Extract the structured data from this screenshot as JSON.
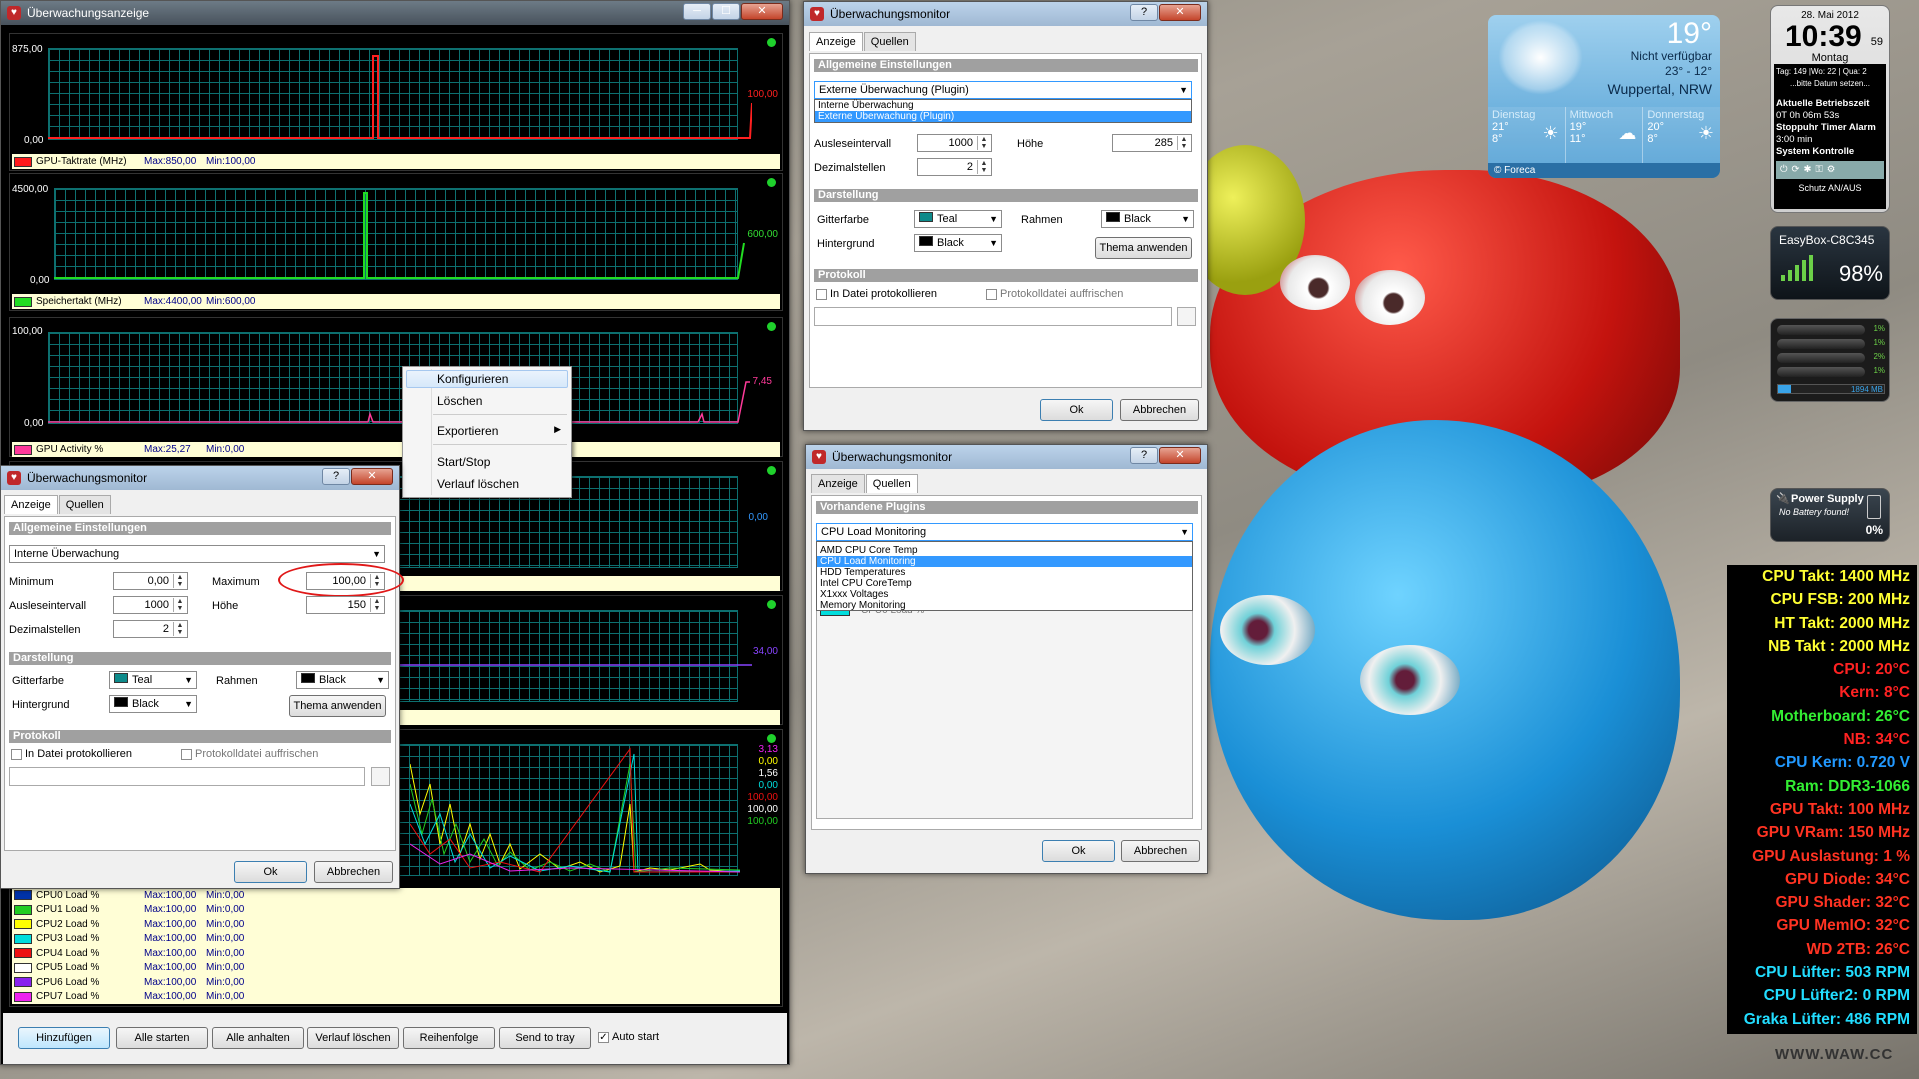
{
  "main_window": {
    "title": "Überwachungsanzeige",
    "btn_min": "─",
    "btn_max": "☐",
    "btn_close": "✕",
    "panels": [
      {
        "top_label": "875,00",
        "bottom_label": "0,00",
        "right_value": "100,00",
        "right_color": "#ff2020",
        "legend": {
          "name": "GPU-Taktrate (MHz)",
          "max": "Max:850,00",
          "min": "Min:100,00",
          "color": "#ff1a1a"
        }
      },
      {
        "top_label": "4500,00",
        "bottom_label": "0,00",
        "right_value": "600,00",
        "right_color": "#33dd33",
        "legend": {
          "name": "Speichertakt (MHz)",
          "max": "Max:4400,00",
          "min": "Min:600,00",
          "color": "#22dd22"
        }
      },
      {
        "top_label": "100,00",
        "bottom_label": "0,00",
        "right_value": "7,45",
        "right_color": "#ff3a9a",
        "legend": {
          "name": "GPU Activity %",
          "max": "Max:25,27",
          "min": "Min:0,00",
          "color": "#ff3a9a"
        }
      },
      {
        "right_value": "0,00",
        "right_color": "#3399ff"
      },
      {
        "right_value": "34,00",
        "right_color": "#8844ff"
      },
      {
        "right_values": [
          "3,13",
          "0,00",
          "1,56",
          "0,00",
          "100,00",
          "100,00",
          "100,00"
        ]
      }
    ],
    "cpu_legend": [
      {
        "name": "CPU0 Load %",
        "max": "Max:100,00",
        "min": "Min:0,00",
        "color": "#0033aa"
      },
      {
        "name": "CPU1 Load %",
        "max": "Max:100,00",
        "min": "Min:0,00",
        "color": "#22cc22"
      },
      {
        "name": "CPU2 Load %",
        "max": "Max:100,00",
        "min": "Min:0,00",
        "color": "#ffff00"
      },
      {
        "name": "CPU3 Load %",
        "max": "Max:100,00",
        "min": "Min:0,00",
        "color": "#00dddd"
      },
      {
        "name": "CPU4 Load %",
        "max": "Max:100,00",
        "min": "Min:0,00",
        "color": "#ee1111"
      },
      {
        "name": "CPU5 Load %",
        "max": "Max:100,00",
        "min": "Min:0,00",
        "color": "#ffffff"
      },
      {
        "name": "CPU6 Load %",
        "max": "Max:100,00",
        "min": "Min:0,00",
        "color": "#8822ee"
      },
      {
        "name": "CPU7 Load %",
        "max": "Max:100,00",
        "min": "Min:0,00",
        "color": "#ee22ee"
      }
    ],
    "buttons": {
      "add": "Hinzufügen",
      "start_all": "Alle starten",
      "stop_all": "Alle anhalten",
      "clear_history": "Verlauf löschen",
      "order": "Reihenfolge",
      "tray": "Send to tray",
      "autostart": "Auto start"
    }
  },
  "context_menu": {
    "items": [
      "Konfigurieren",
      "Löschen",
      "Exportieren",
      "Start/Stop",
      "Verlauf löschen"
    ]
  },
  "dialog_left": {
    "title": "Überwachungsmonitor",
    "btn_help": "?",
    "btn_close": "✕",
    "tab_display": "Anzeige",
    "tab_sources": "Quellen",
    "sect_general": "Allgemeine Einstellungen",
    "mode": "Interne Überwachung",
    "min_label": "Minimum",
    "min_value": "0,00",
    "max_label": "Maximum",
    "max_value": "100,00",
    "interval_label": "Ausleseintervall",
    "interval_value": "1000",
    "height_label": "Höhe",
    "height_value": "150",
    "decimals_label": "Dezimalstellen",
    "decimals_value": "2",
    "sect_display": "Darstellung",
    "grid_label": "Gitterfarbe",
    "grid_value": "Teal",
    "frame_label": "Rahmen",
    "frame_value": "Black",
    "bg_label": "Hintergrund",
    "bg_value": "Black",
    "apply_theme": "Thema anwenden",
    "sect_log": "Protokoll",
    "log_file": "In Datei protokollieren",
    "log_refresh": "Protokolldatei auffrischen",
    "ok": "Ok",
    "cancel": "Abbrechen"
  },
  "dialog_top": {
    "title": "Überwachungsmonitor",
    "btn_help": "?",
    "btn_close": "✕",
    "tab_display": "Anzeige",
    "tab_sources": "Quellen",
    "sect_general": "Allgemeine Einstellungen",
    "mode": "Externe Überwachung (Plugin)",
    "mode_options": [
      "Interne Überwachung",
      "Externe Überwachung (Plugin)"
    ],
    "interval_label": "Ausleseintervall",
    "interval_value": "1000",
    "height_label": "Höhe",
    "height_value": "285",
    "decimals_label": "Dezimalstellen",
    "decimals_value": "2",
    "sect_display": "Darstellung",
    "grid_label": "Gitterfarbe",
    "grid_value": "Teal",
    "frame_label": "Rahmen",
    "frame_value": "Black",
    "bg_label": "Hintergrund",
    "bg_value": "Black",
    "apply_theme": "Thema anwenden",
    "sect_log": "Protokoll",
    "log_file": "In Datei protokollieren",
    "log_refresh": "Protokolldatei auffrischen",
    "ok": "Ok",
    "cancel": "Abbrechen"
  },
  "dialog_bottom": {
    "title": "Überwachungsmonitor",
    "btn_help": "?",
    "btn_close": "✕",
    "tab_display": "Anzeige",
    "tab_sources": "Quellen",
    "sect_plugins": "Vorhandene Plugins",
    "plugin": "CPU Load Monitoring",
    "plugin_options": [
      "AMD CPU Core Temp",
      "CPU Load Monitoring",
      "HDD Temperatures",
      "Intel CPU CoreTemp",
      "X1xxx Voltages",
      "Memory Monitoring"
    ],
    "behind_text": "CPU0 Load %",
    "ok": "Ok",
    "cancel": "Abbrechen"
  },
  "weather": {
    "temp": "19°",
    "status": "Nicht verfügbar",
    "range": "23° - 12°",
    "city": "Wuppertal, NRW",
    "days": [
      {
        "name": "Dienstag",
        "hi": "21°",
        "lo": "8°"
      },
      {
        "name": "Mittwoch",
        "hi": "19°",
        "lo": "11°"
      },
      {
        "name": "Donnerstag",
        "hi": "20°",
        "lo": "8°"
      }
    ],
    "provider": "Foreca"
  },
  "clock": {
    "date": "28. Mai 2012",
    "time": "10:39",
    "seconds": "59",
    "weekday": "Montag",
    "info": "Tag: 149 |Wo: 22 | Qua: 2",
    "hint": "...bitte Datum setzen...",
    "uptime_label": "Aktuelle Betriebszeit",
    "uptime": "0T 0h 06m 53s",
    "alarm": "Stoppuhr Timer Alarm",
    "alarm_time": "3:00 min",
    "sys": "System Kontrolle",
    "protect": "Schutz AN/AUS"
  },
  "wifi": {
    "name": "EasyBox-C8C345",
    "percent": "98%"
  },
  "cpu_gadget": {
    "bars": [
      "1%",
      "1%",
      "2%",
      "1%"
    ],
    "ram": "1894 MB"
  },
  "power": {
    "title": "Power Supply",
    "status": "No Battery found!",
    "percent": "0%"
  },
  "stats": [
    {
      "text": "CPU Takt: 1400 MHz",
      "color": "#ffff33"
    },
    {
      "text": "CPU FSB: 200 MHz",
      "color": "#ffff33"
    },
    {
      "text": "HT Takt: 2000 MHz",
      "color": "#ffff33"
    },
    {
      "text": "NB Takt : 2000 MHz",
      "color": "#ffff33"
    },
    {
      "text": "CPU: 20°C",
      "color": "#ff2222"
    },
    {
      "text": "Kern: 8°C",
      "color": "#ff2222"
    },
    {
      "text": "Motherboard: 26°C",
      "color": "#33ee33"
    },
    {
      "text": "NB: 34°C",
      "color": "#ff2222"
    },
    {
      "text": "CPU Kern: 0.720 V",
      "color": "#2299ff"
    },
    {
      "text": "Ram: DDR3-1066",
      "color": "#33ee33"
    },
    {
      "text": "GPU Takt: 100 MHz",
      "color": "#ff3322"
    },
    {
      "text": "GPU VRam: 150 MHz",
      "color": "#ff3322"
    },
    {
      "text": "GPU Auslastung: 1 %",
      "color": "#ff3322"
    },
    {
      "text": "GPU Diode: 34°C",
      "color": "#ff3322"
    },
    {
      "text": "GPU Shader: 32°C",
      "color": "#ff3322"
    },
    {
      "text": "GPU MemIO: 32°C",
      "color": "#ff3322"
    },
    {
      "text": "WD 2TB: 26°C",
      "color": "#ff3322"
    },
    {
      "text": "CPU Lüfter: 503 RPM",
      "color": "#22ddff"
    },
    {
      "text": "CPU Lüfter2: 0 RPM",
      "color": "#22ddff"
    },
    {
      "text": "Graka Lüfter: 486 RPM",
      "color": "#22ddff"
    }
  ],
  "watermark": "WWW.WAW.CC"
}
